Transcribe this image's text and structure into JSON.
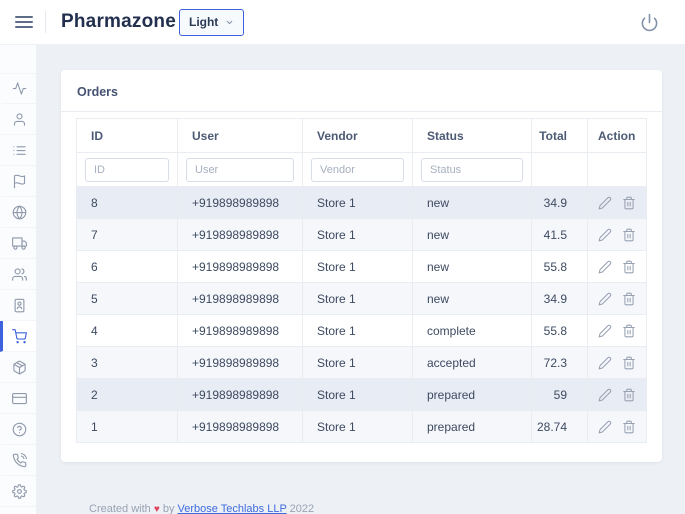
{
  "header": {
    "brand": "Pharmazone",
    "theme_label": "Light"
  },
  "sidebar": {
    "items": [
      {
        "icon": "activity",
        "active": false
      },
      {
        "icon": "user",
        "active": false
      },
      {
        "icon": "list",
        "active": false
      },
      {
        "icon": "flag",
        "active": false
      },
      {
        "icon": "globe",
        "active": false
      },
      {
        "icon": "truck",
        "active": false
      },
      {
        "icon": "users",
        "active": false
      },
      {
        "icon": "user-badge",
        "active": false
      },
      {
        "icon": "shopping-cart",
        "active": true
      },
      {
        "icon": "package",
        "active": false
      },
      {
        "icon": "credit-card",
        "active": false
      },
      {
        "icon": "help-circle",
        "active": false
      },
      {
        "icon": "phone-call",
        "active": false
      },
      {
        "icon": "gear",
        "active": false
      }
    ]
  },
  "card": {
    "title": "Orders"
  },
  "table": {
    "columns": [
      {
        "label": "ID",
        "key": "id",
        "filter_placeholder": "ID"
      },
      {
        "label": "User",
        "key": "user",
        "filter_placeholder": "User"
      },
      {
        "label": "Vendor",
        "key": "vendor",
        "filter_placeholder": "Vendor"
      },
      {
        "label": "Status",
        "key": "status",
        "filter_placeholder": "Status"
      },
      {
        "label": "Total",
        "key": "total"
      },
      {
        "label": "Action",
        "key": "action"
      }
    ],
    "rows": [
      {
        "id": "8",
        "user": "+919898989898",
        "vendor": "Store 1",
        "status": "new",
        "total": "34.9",
        "highlighted": true
      },
      {
        "id": "7",
        "user": "+919898989898",
        "vendor": "Store 1",
        "status": "new",
        "total": "41.5",
        "highlighted": false
      },
      {
        "id": "6",
        "user": "+919898989898",
        "vendor": "Store 1",
        "status": "new",
        "total": "55.8",
        "highlighted": false
      },
      {
        "id": "5",
        "user": "+919898989898",
        "vendor": "Store 1",
        "status": "new",
        "total": "34.9",
        "highlighted": false
      },
      {
        "id": "4",
        "user": "+919898989898",
        "vendor": "Store 1",
        "status": "complete",
        "total": "55.8",
        "highlighted": false
      },
      {
        "id": "3",
        "user": "+919898989898",
        "vendor": "Store 1",
        "status": "accepted",
        "total": "72.3",
        "highlighted": false
      },
      {
        "id": "2",
        "user": "+919898989898",
        "vendor": "Store 1",
        "status": "prepared",
        "total": "59",
        "highlighted": true
      },
      {
        "id": "1",
        "user": "+919898989898",
        "vendor": "Store 1",
        "status": "prepared",
        "total": "28.74",
        "highlighted": false
      }
    ]
  },
  "footer": {
    "text_before": "Created with",
    "heart": "♥",
    "text_middle": "by",
    "link_label": "Verbose Techlabs LLP",
    "year": "2022"
  },
  "colors": {
    "accent": "#3e62de",
    "link": "#3e6be0",
    "heart": "#e0455e",
    "row_stripe": "#f5f7fb",
    "row_highlight": "#e8ecf4"
  }
}
